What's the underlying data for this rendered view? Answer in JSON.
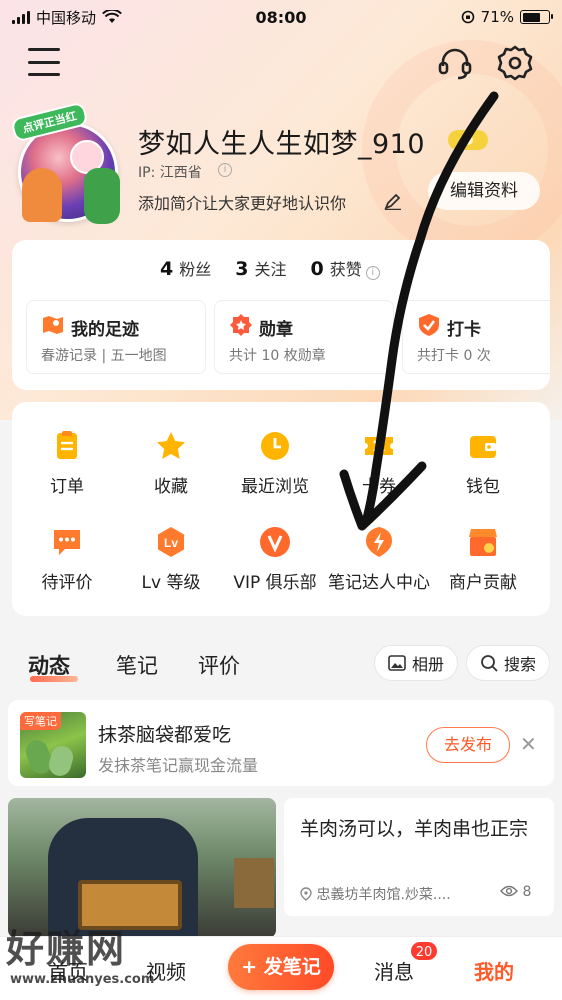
{
  "status_bar": {
    "carrier": "中国移动",
    "time": "08:00",
    "battery": "71%",
    "battery_level": 0.71
  },
  "header": {
    "menu_icon": "menu-icon",
    "service_icon": "headset-icon",
    "settings_icon": "gear-icon"
  },
  "profile": {
    "avatar_tag": "点评正当红",
    "username": "梦如人生人生如梦_910",
    "ip": "IP: 江西省",
    "bio": "添加简介让大家更好地认识你",
    "edit_label": "编辑资料"
  },
  "stats": [
    {
      "value": "4",
      "label": "粉丝"
    },
    {
      "value": "3",
      "label": "关注"
    },
    {
      "value": "0",
      "label": "获赞"
    }
  ],
  "mini_cards": [
    {
      "title": "我的足迹",
      "subtitle": "春游记录 | 五一地图",
      "icon": "map-icon",
      "color": "#ff7a2c"
    },
    {
      "title": "勋章",
      "subtitle": "共计 10 枚勋章",
      "icon": "medal-icon",
      "color": "#ff5a3c"
    },
    {
      "title": "打卡",
      "subtitle": "共打卡 0 次",
      "icon": "checkin-icon",
      "color": "#ff6a2c"
    }
  ],
  "functions": [
    {
      "label": "订单",
      "icon": "order-icon"
    },
    {
      "label": "收藏",
      "icon": "star-icon"
    },
    {
      "label": "最近浏览",
      "icon": "clock-icon"
    },
    {
      "label": "卡券",
      "icon": "coupon-icon"
    },
    {
      "label": "钱包",
      "icon": "wallet-icon"
    },
    {
      "label": "待评价",
      "icon": "comment-icon"
    },
    {
      "label": "Lv 等级",
      "icon": "level-icon"
    },
    {
      "label": "VIP 俱乐部",
      "icon": "vip-icon"
    },
    {
      "label": "笔记达人中心",
      "icon": "lightning-icon"
    },
    {
      "label": "商户贡献",
      "icon": "store-icon"
    }
  ],
  "tabs": [
    {
      "label": "动态",
      "active": true
    },
    {
      "label": "笔记",
      "active": false
    },
    {
      "label": "评价",
      "active": false
    }
  ],
  "actions": {
    "album": "相册",
    "search": "搜索"
  },
  "prompt": {
    "tag": "写笔记",
    "title": "抹茶脑袋都爱吃",
    "subtitle": "发抹茶笔记赢现金流量",
    "button": "去发布"
  },
  "feed": {
    "title": "羊肉汤可以，羊肉串也正宗",
    "location": "忠義坊羊肉馆.炒菜....",
    "views": "8"
  },
  "bottom_nav": {
    "home": "首页",
    "video": "视频",
    "post": "+ 发笔记",
    "messages": "消息",
    "messages_badge": "20",
    "me": "我的"
  },
  "watermark": {
    "text": "好赚网",
    "url": "www.zhuanyes.com"
  },
  "colors": {
    "accent": "#ff5a28",
    "icon_orange": "#ff8a1c",
    "icon_yellow": "#ffb400"
  }
}
